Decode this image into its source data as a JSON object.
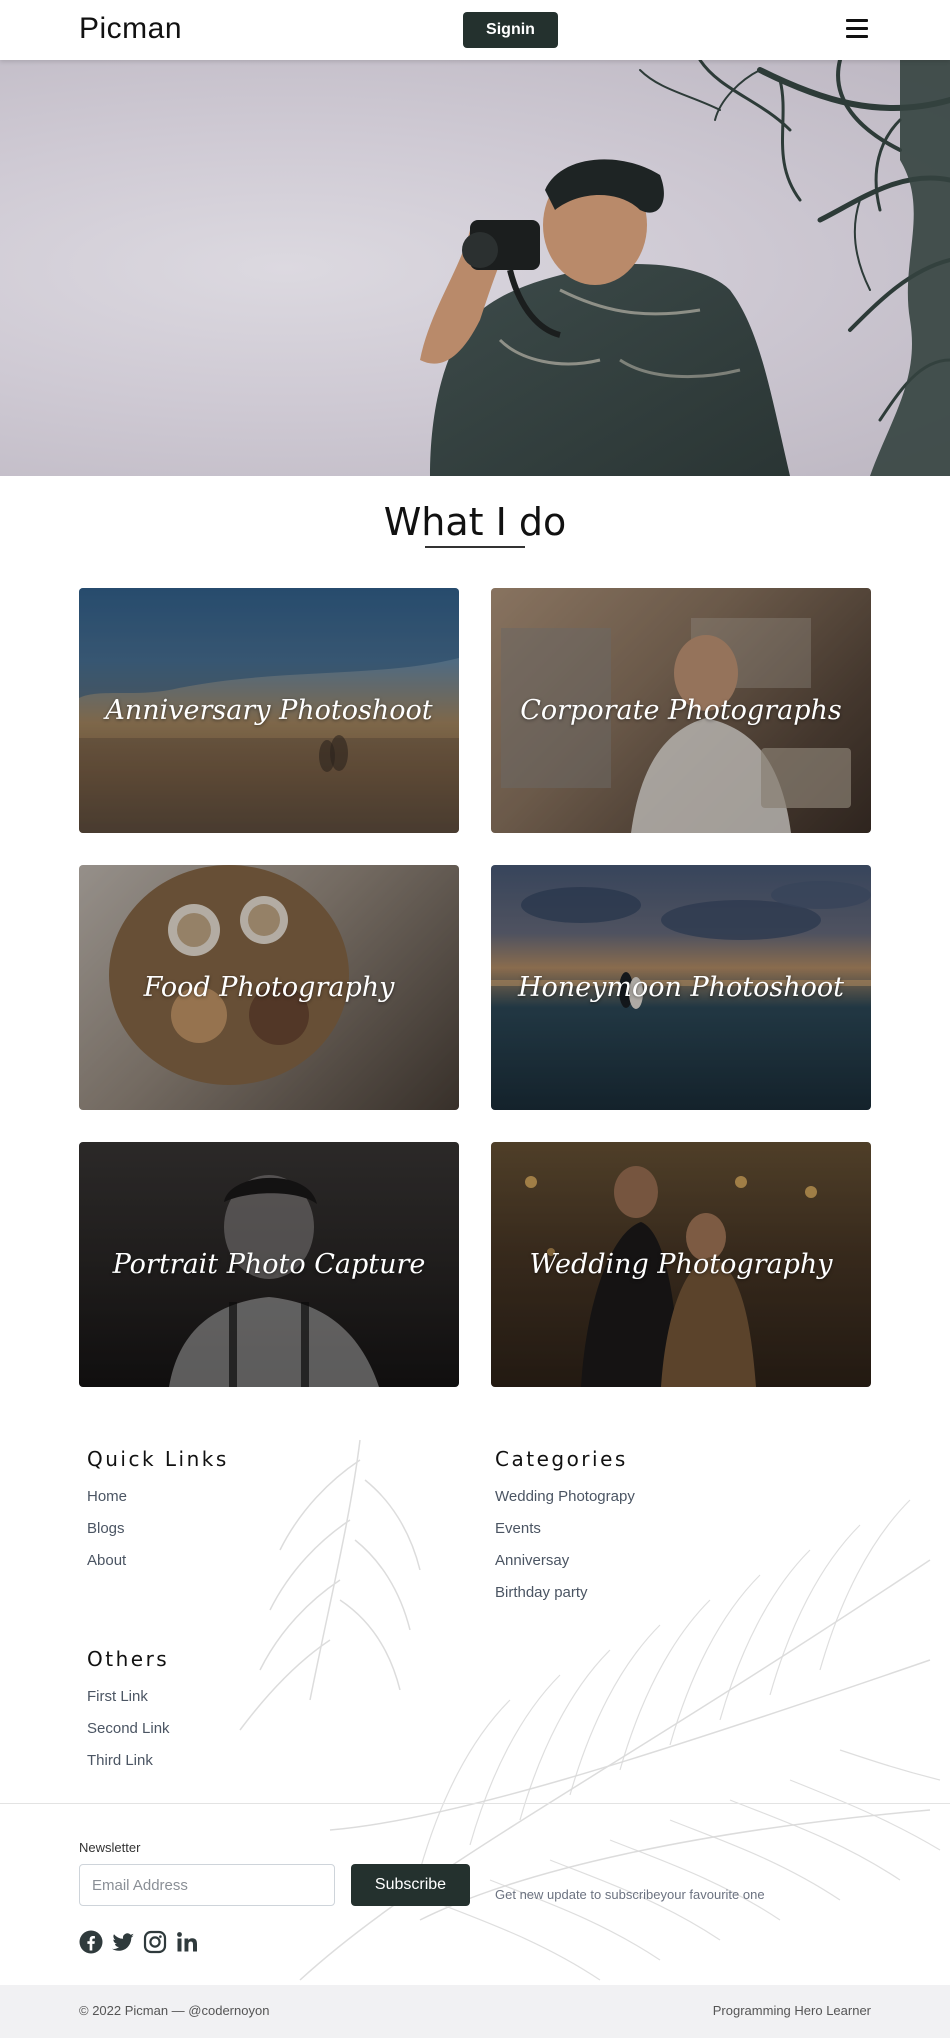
{
  "navbar": {
    "brand": "Picman",
    "signin_label": "Signin",
    "menu_icon": "hamburger-menu-icon"
  },
  "hero": {
    "image": "photographer-with-camera-photo"
  },
  "services": {
    "title": "What I do",
    "cards": [
      {
        "label": "Anniversary Photoshoot"
      },
      {
        "label": "Corporate Photographs"
      },
      {
        "label": "Food Photography"
      },
      {
        "label": "Honeymoon Photoshoot"
      },
      {
        "label": "Portrait Photo Capture"
      },
      {
        "label": "Wedding Photography"
      }
    ]
  },
  "footer": {
    "quick_links": {
      "title": "Quick Links",
      "items": [
        "Home",
        "Blogs",
        "About"
      ]
    },
    "categories": {
      "title": "Categories",
      "items": [
        "Wedding Photograpy",
        "Events",
        "Anniversay",
        "Birthday party"
      ]
    },
    "others": {
      "title": "Others",
      "items": [
        "First Link",
        "Second Link",
        "Third Link"
      ]
    },
    "newsletter": {
      "label": "Newsletter",
      "placeholder": "Email Address",
      "value": "",
      "button_label": "Subscribe",
      "note": "Get new update to subscribeyour favourite one"
    },
    "social_icons": [
      "facebook-icon",
      "twitter-icon",
      "instagram-icon",
      "linkedin-icon"
    ]
  },
  "bottom_bar": {
    "copyright": "© 2022 Picman — @codernoyon",
    "credit": "Programming Hero Learner"
  },
  "colors": {
    "accent_dark": "#24312e",
    "footer_bar": "#f1f1f3",
    "link_text": "#4b5563"
  }
}
